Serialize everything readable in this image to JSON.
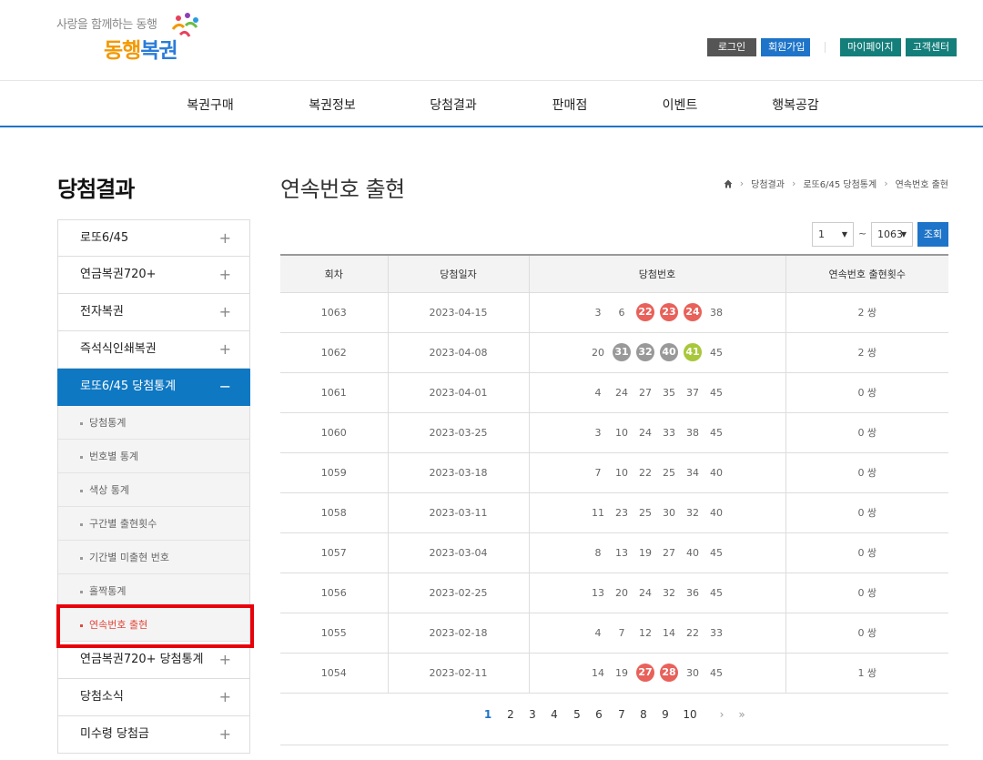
{
  "header": {
    "tagline": "사랑을 함께하는 동행",
    "logo_part1": "동행",
    "logo_part2": "복권",
    "util_left": [
      "로그인",
      "회원가입"
    ],
    "util_right": [
      "마이페이지",
      "고객센터"
    ]
  },
  "gnb": [
    "복권구매",
    "복권정보",
    "당첨결과",
    "판매점",
    "이벤트",
    "행복공감"
  ],
  "sidebar": {
    "title": "당첨결과",
    "items_top": [
      {
        "label": "로또6/45",
        "icon": "+"
      },
      {
        "label": "연금복권720+",
        "icon": "+"
      },
      {
        "label": "전자복권",
        "icon": "+"
      },
      {
        "label": "즉석식인쇄복권",
        "icon": "+"
      }
    ],
    "active": {
      "label": "로또6/45 당첨통계",
      "icon": "−"
    },
    "sub": [
      "당첨통계",
      "번호별 통계",
      "색상 통계",
      "구간별 출현횟수",
      "기간별 미출현 번호",
      "홀짝통계",
      "연속번호 출현"
    ],
    "items_bottom": [
      {
        "label": "연금복권720+ 당첨통계",
        "icon": "+"
      },
      {
        "label": "당첨소식",
        "icon": "+"
      },
      {
        "label": "미수령 당첨금",
        "icon": "+"
      }
    ]
  },
  "main": {
    "title": "연속번호 출현",
    "breadcrumb": [
      "당첨결과",
      "로또6/45 당첨통계",
      "연속번호 출현"
    ],
    "filter": {
      "from": "1",
      "tilde": "~",
      "to": "1063",
      "button": "조회"
    },
    "columns": [
      "회차",
      "당첨일자",
      "당첨번호",
      "연속번호 출현횟수"
    ],
    "rows": [
      {
        "round": "1063",
        "date": "2023-04-15",
        "numbers": [
          {
            "n": "3"
          },
          {
            "n": "6"
          },
          {
            "n": "22",
            "c": "#e8615a"
          },
          {
            "n": "23",
            "c": "#e8615a"
          },
          {
            "n": "24",
            "c": "#e8615a"
          },
          {
            "n": "38"
          }
        ],
        "count": "2 쌍"
      },
      {
        "round": "1062",
        "date": "2023-04-08",
        "numbers": [
          {
            "n": "20"
          },
          {
            "n": "31",
            "c": "#999999"
          },
          {
            "n": "32",
            "c": "#999999"
          },
          {
            "n": "40",
            "c": "#999999"
          },
          {
            "n": "41",
            "c": "#a8c73a"
          },
          {
            "n": "45"
          }
        ],
        "count": "2 쌍"
      },
      {
        "round": "1061",
        "date": "2023-04-01",
        "numbers": [
          {
            "n": "4"
          },
          {
            "n": "24"
          },
          {
            "n": "27"
          },
          {
            "n": "35"
          },
          {
            "n": "37"
          },
          {
            "n": "45"
          }
        ],
        "count": "0 쌍"
      },
      {
        "round": "1060",
        "date": "2023-03-25",
        "numbers": [
          {
            "n": "3"
          },
          {
            "n": "10"
          },
          {
            "n": "24"
          },
          {
            "n": "33"
          },
          {
            "n": "38"
          },
          {
            "n": "45"
          }
        ],
        "count": "0 쌍"
      },
      {
        "round": "1059",
        "date": "2023-03-18",
        "numbers": [
          {
            "n": "7"
          },
          {
            "n": "10"
          },
          {
            "n": "22"
          },
          {
            "n": "25"
          },
          {
            "n": "34"
          },
          {
            "n": "40"
          }
        ],
        "count": "0 쌍"
      },
      {
        "round": "1058",
        "date": "2023-03-11",
        "numbers": [
          {
            "n": "11"
          },
          {
            "n": "23"
          },
          {
            "n": "25"
          },
          {
            "n": "30"
          },
          {
            "n": "32"
          },
          {
            "n": "40"
          }
        ],
        "count": "0 쌍"
      },
      {
        "round": "1057",
        "date": "2023-03-04",
        "numbers": [
          {
            "n": "8"
          },
          {
            "n": "13"
          },
          {
            "n": "19"
          },
          {
            "n": "27"
          },
          {
            "n": "40"
          },
          {
            "n": "45"
          }
        ],
        "count": "0 쌍"
      },
      {
        "round": "1056",
        "date": "2023-02-25",
        "numbers": [
          {
            "n": "13"
          },
          {
            "n": "20"
          },
          {
            "n": "24"
          },
          {
            "n": "32"
          },
          {
            "n": "36"
          },
          {
            "n": "45"
          }
        ],
        "count": "0 쌍"
      },
      {
        "round": "1055",
        "date": "2023-02-18",
        "numbers": [
          {
            "n": "4"
          },
          {
            "n": "7"
          },
          {
            "n": "12"
          },
          {
            "n": "14"
          },
          {
            "n": "22"
          },
          {
            "n": "33"
          }
        ],
        "count": "0 쌍"
      },
      {
        "round": "1054",
        "date": "2023-02-11",
        "numbers": [
          {
            "n": "14"
          },
          {
            "n": "19"
          },
          {
            "n": "27",
            "c": "#e8615a"
          },
          {
            "n": "28",
            "c": "#e8615a"
          },
          {
            "n": "30"
          },
          {
            "n": "45"
          }
        ],
        "count": "1 쌍"
      }
    ],
    "pagination": {
      "pages": [
        "1",
        "2",
        "3",
        "4",
        "5",
        "6",
        "7",
        "8",
        "9",
        "10"
      ],
      "current": "1",
      "next": "›",
      "last": "»"
    }
  }
}
